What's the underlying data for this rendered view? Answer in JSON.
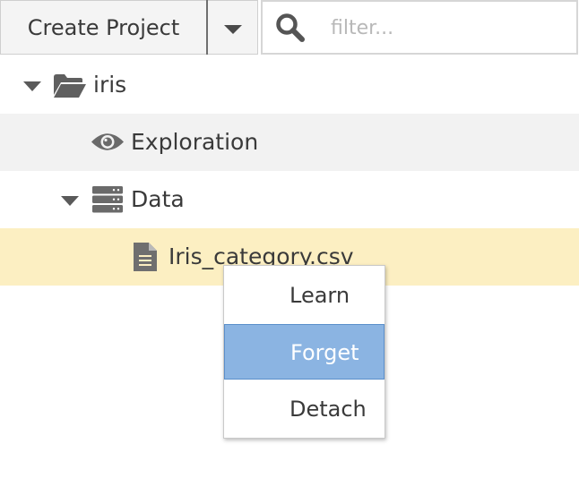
{
  "toolbar": {
    "create_label": "Create Project",
    "filter_placeholder": "filter..."
  },
  "tree": {
    "project": "iris",
    "exploration": "Exploration",
    "data_folder": "Data",
    "file": "Iris_category.csv"
  },
  "context_menu": {
    "items": [
      "Learn",
      "Forget",
      "Detach"
    ],
    "selected": "Forget"
  },
  "colors": {
    "selected_row": "#fcefc2",
    "hover_row": "#f2f2f2",
    "menu_highlight": "#8bb4e2"
  },
  "icons": {
    "expand": "caret-down-icon",
    "project": "folder-open-icon",
    "exploration": "eye-icon",
    "data": "server-icon",
    "file": "file-text-icon",
    "search": "search-icon"
  }
}
